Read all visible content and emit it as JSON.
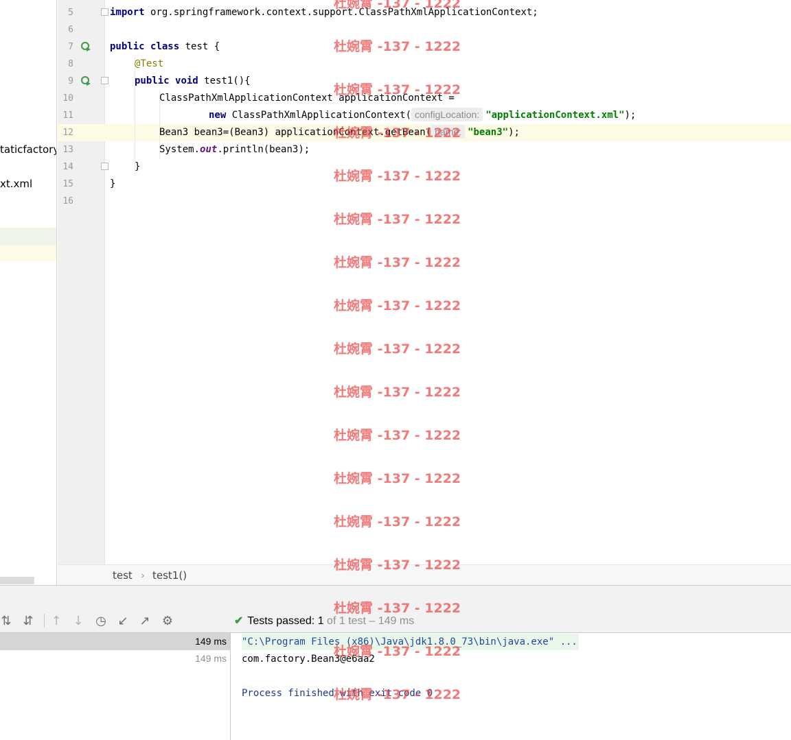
{
  "project": {
    "items": [
      "taticfactory",
      "xt.xml"
    ]
  },
  "editor": {
    "line_numbers": [
      "5",
      "6",
      "7",
      "8",
      "9",
      "10",
      "11",
      "12",
      "13",
      "14",
      "15",
      "16"
    ],
    "lines": {
      "l5": {
        "kw": "import",
        "text": " org.springframework.context.support.ClassPathXmlApplicationContext;"
      },
      "l7": {
        "kw1": "public",
        "kw2": "class",
        "text": " test {"
      },
      "l8": {
        "annotation": "@Test"
      },
      "l9": {
        "kw1": "public",
        "kw2": "void",
        "text": " test1(){"
      },
      "l10": {
        "text": "ClassPathXmlApplicationContext applicationContext ="
      },
      "l11": {
        "kw": "new",
        "text": " ClassPathXmlApplicationContext(",
        "hint": "configLocation:",
        "string": "\"applicationContext.xml\"",
        "end": ");"
      },
      "l12": {
        "text": "Bean3 bean3=(Bean3) applicationContext.getBean(",
        "hint": "name:",
        "string": "\"bean3\"",
        "end": ");"
      },
      "l13": {
        "text1": "System.",
        "field": "out",
        "text2": ".println(bean3);"
      },
      "l14": {
        "text": "}"
      },
      "l15": {
        "text": "}"
      }
    }
  },
  "breadcrumb": {
    "class_name": "test",
    "separator": "›",
    "method_name": "test1()"
  },
  "run": {
    "status_check": "✔",
    "status_label": "Tests passed: ",
    "status_count": "1",
    "status_detail": " of 1 test – 149 ms",
    "tree": [
      {
        "time": "149 ms"
      },
      {
        "time": "149 ms"
      }
    ],
    "console": [
      "\"C:\\Program Files (x86)\\Java\\jdk1.8.0_73\\bin\\java.exe\" ...",
      "com.factory.Bean3@e6aa2",
      "",
      "Process finished with exit code 0"
    ],
    "toolbar_icons": [
      "expand-all-icon",
      "collapse-all-icon",
      "previous-failed-icon",
      "next-failed-icon",
      "history-icon",
      "import-tests-icon",
      "export-tests-icon",
      "settings-icon"
    ]
  },
  "watermark": {
    "text": "杜婉霄 -137 - 1222"
  },
  "colors": {
    "keyword": "#000080",
    "annotation": "#808000",
    "string": "#008000",
    "field": "#660e7a",
    "caret_line": "#fdfbe6",
    "watermark": "#eb4646",
    "pass_check": "#3d9a3d"
  }
}
